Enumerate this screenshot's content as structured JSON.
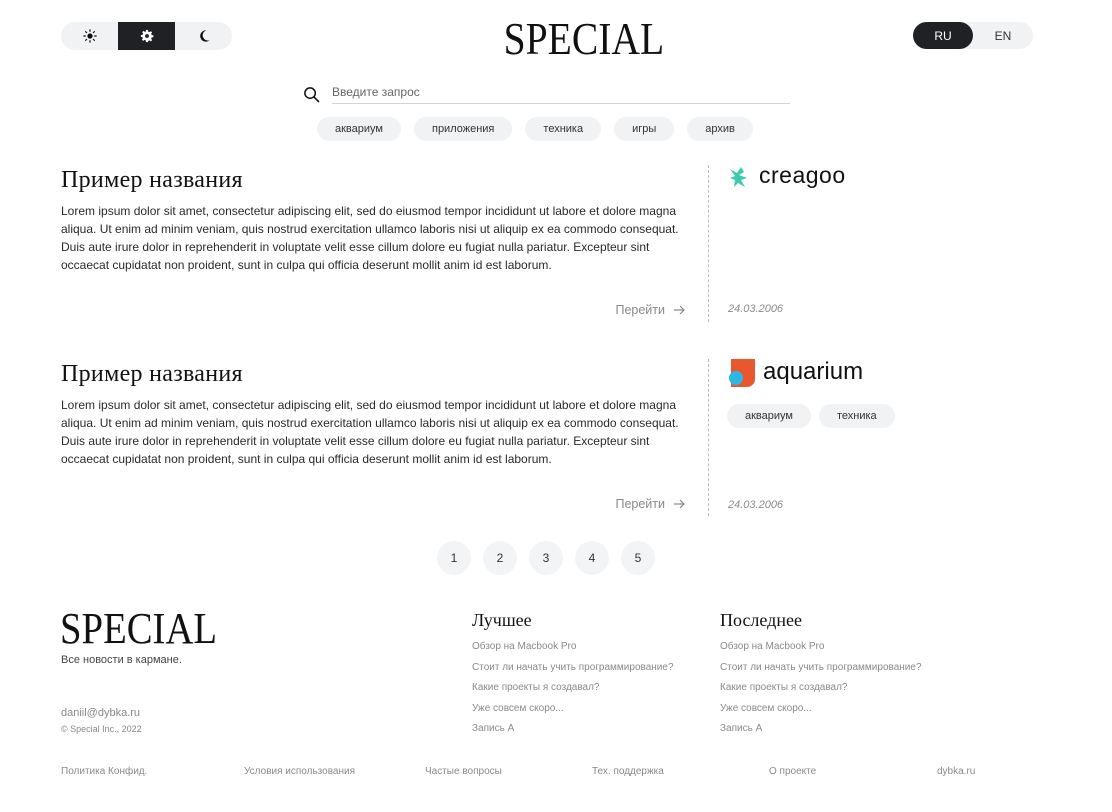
{
  "header": {
    "theme_modes": [
      "sun-icon",
      "gear-icon",
      "moon-icon"
    ],
    "active_theme": "gear-icon",
    "logo": "SPECIAL",
    "languages": [
      "RU",
      "EN"
    ],
    "active_language": "RU"
  },
  "search": {
    "placeholder": "Введите запрос",
    "tags": [
      "аквариум",
      "приложения",
      "техника",
      "игры",
      "архив"
    ]
  },
  "articles": [
    {
      "title": "Пример названия",
      "text": "Lorem ipsum dolor sit amet, consectetur adipiscing elit, sed do eiusmod tempor incididunt ut labore et dolore magna aliqua. Ut enim ad minim veniam, quis nostrud exercitation ullamco laboris nisi ut aliquip ex ea commodo consequat. Duis aute irure dolor in reprehenderit in voluptate velit esse cillum dolore eu fugiat nulla pariatur. Excepteur sint occaecat cupidatat non proident, sunt in culpa qui officia deserunt mollit anim id est laborum.",
      "link_label": "Перейти",
      "brand": "creagoo",
      "brand_color": "#3ec9b0",
      "date": "24.03.2006",
      "tags": []
    },
    {
      "title": "Пример названия",
      "text": "Lorem ipsum dolor sit amet, consectetur adipiscing elit, sed do eiusmod tempor incididunt ut labore et dolore magna aliqua. Ut enim ad minim veniam, quis nostrud exercitation ullamco laboris nisi ut aliquip ex ea commodo consequat. Duis aute irure dolor in reprehenderit in voluptate velit esse cillum dolore eu fugiat nulla pariatur. Excepteur sint occaecat cupidatat non proident, sunt in culpa qui officia deserunt mollit anim id est laborum.",
      "link_label": "Перейти",
      "brand": "aquarium",
      "brand_color": "#e8572e",
      "date": "24.03.2006",
      "tags": [
        "аквариум",
        "техника"
      ]
    }
  ],
  "pagination": [
    "1",
    "2",
    "3",
    "4",
    "5"
  ],
  "footer": {
    "logo": "SPECIAL",
    "tagline": "Все новости в кармане.",
    "email": "daniil@dybka.ru",
    "copyright": "© Special Inc., 2022",
    "best": {
      "title": "Лучшее",
      "links": [
        "Обзор на Macbook Pro",
        "Стоит ли начать учить программирование?",
        "Какие проекты я создавал?",
        "Уже совсем скоро...",
        "Запись А"
      ]
    },
    "latest": {
      "title": "Последнее",
      "links": [
        "Обзор на Macbook Pro",
        "Стоит ли начать учить программирование?",
        "Какие проекты я создавал?",
        "Уже совсем скоро...",
        "Запись А"
      ]
    },
    "bottom_links": [
      "Политика Конфид.",
      "Условия использования",
      "Частые вопросы",
      "Тех. поддержка",
      "О проекте",
      "dybka.ru"
    ]
  }
}
